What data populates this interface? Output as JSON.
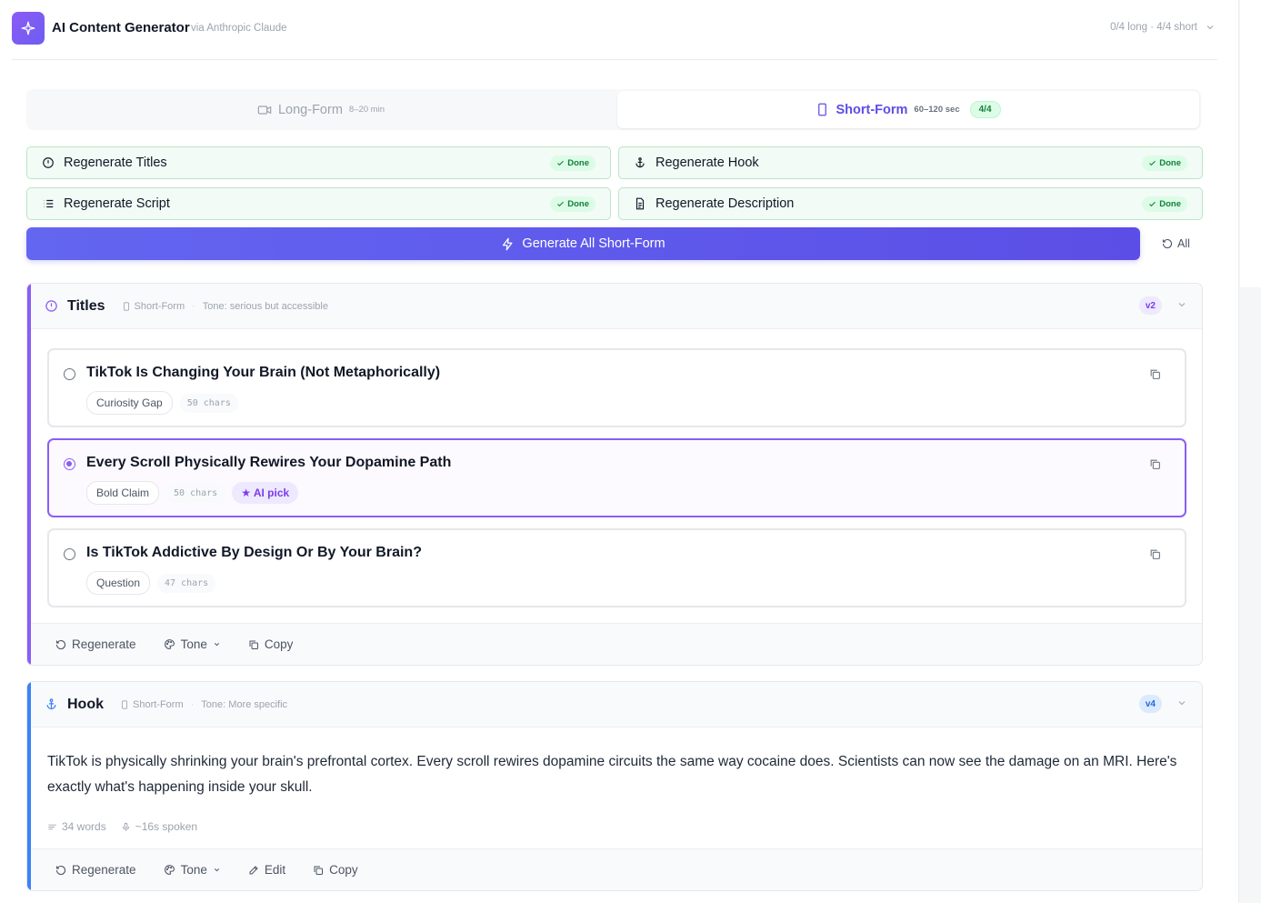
{
  "header": {
    "title": "AI Content Generator",
    "subtitle": "via Anthropic Claude",
    "status": "0/4 long · 4/4 short",
    "logo_icon": "sparkle-icon",
    "accent": "#5b4ee6"
  },
  "tabs": [
    {
      "label": "Long-Form",
      "duration": "8–20 min",
      "icon": "video-icon",
      "active": false
    },
    {
      "label": "Short-Form",
      "duration": "60–120 sec",
      "badge": "4/4",
      "icon": "phone-icon",
      "active": true
    }
  ],
  "regen_buttons": [
    {
      "label": "Regenerate Titles",
      "status": "Done",
      "icon": "alert-circle-icon"
    },
    {
      "label": "Regenerate Hook",
      "status": "Done",
      "icon": "anchor-icon"
    },
    {
      "label": "Regenerate Script",
      "status": "Done",
      "icon": "list-icon"
    },
    {
      "label": "Regenerate Description",
      "status": "Done",
      "icon": "document-icon"
    }
  ],
  "generate_all": {
    "label": "Generate All Short-Form",
    "all_label": "All"
  },
  "titles_section": {
    "title": "Titles",
    "format": "Short-Form",
    "tone": "Tone: serious but accessible",
    "version": "v2",
    "accent": "#8b5cf6",
    "options": [
      {
        "title": "TikTok Is Changing Your Brain (Not Metaphorically)",
        "tag": "Curiosity Gap",
        "chars": "50 chars",
        "selected": false
      },
      {
        "title": "Every Scroll Physically Rewires Your Dopamine Path",
        "tag": "Bold Claim",
        "chars": "50 chars",
        "ai_pick": "★ AI pick",
        "selected": true
      },
      {
        "title": "Is TikTok Addictive By Design Or By Your Brain?",
        "tag": "Question",
        "chars": "47 chars",
        "selected": false
      }
    ],
    "footer": {
      "regenerate": "Regenerate",
      "tone": "Tone",
      "copy": "Copy"
    }
  },
  "hook_section": {
    "title": "Hook",
    "format": "Short-Form",
    "tone": "Tone: More specific",
    "version": "v4",
    "accent": "#3b82f6",
    "text": "TikTok is physically shrinking your brain's prefrontal cortex. Every scroll rewires dopamine circuits the same way cocaine does. Scientists can now see the damage on an MRI. Here's exactly what's happening inside your skull.",
    "words": "34 words",
    "spoken": "~16s spoken",
    "footer": {
      "regenerate": "Regenerate",
      "tone": "Tone",
      "edit": "Edit",
      "copy": "Copy"
    }
  }
}
